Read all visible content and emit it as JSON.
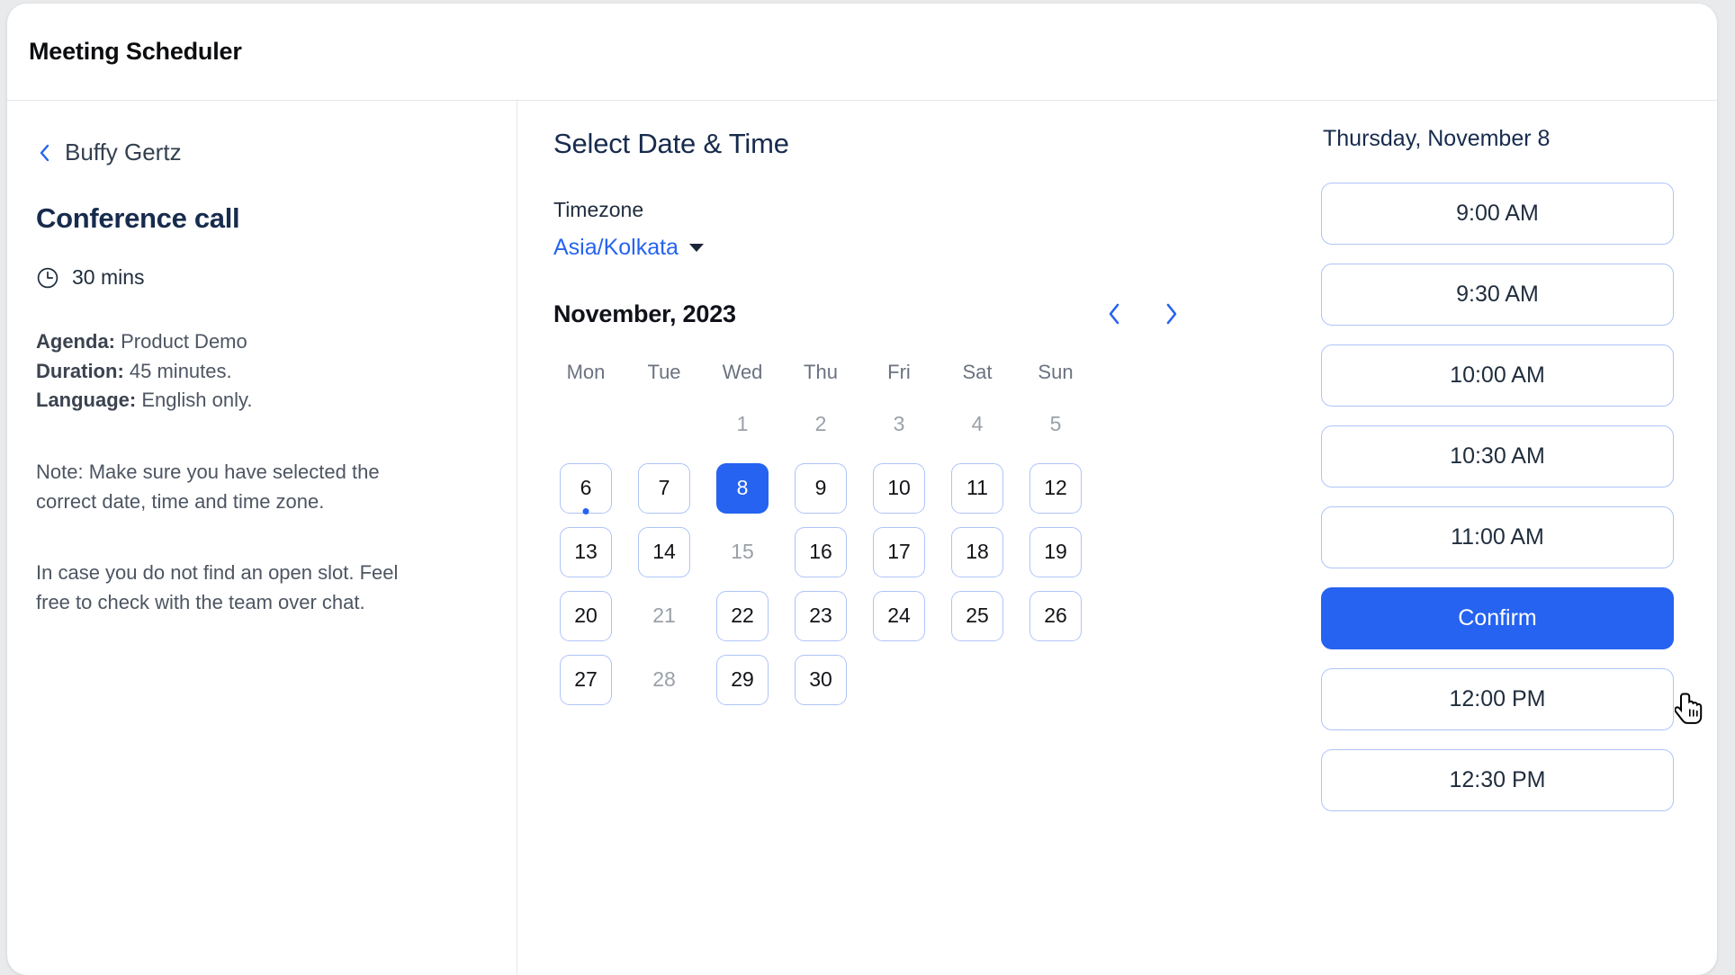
{
  "header": {
    "title": "Meeting Scheduler"
  },
  "sidebar": {
    "back_label": "Buffy Gertz",
    "event_title": "Conference call",
    "duration": "30 mins",
    "meta": [
      {
        "label": "Agenda:",
        "value": "Product Demo"
      },
      {
        "label": "Duration:",
        "value": "45 minutes."
      },
      {
        "label": "Language:",
        "value": "English only."
      }
    ],
    "note_1": "Note: Make sure you have selected the correct date, time and time zone.",
    "note_2": "In case you do not find an open slot. Feel free to check with the team over chat."
  },
  "calendar": {
    "section_title": "Select Date & Time",
    "timezone_label": "Timezone",
    "timezone_value": "Asia/Kolkata",
    "month_label": "November, 2023",
    "prev_label": "‹",
    "next_label": "›",
    "weekdays": [
      "Mon",
      "Tue",
      "Wed",
      "Thu",
      "Fri",
      "Sat",
      "Sun"
    ],
    "weeks": [
      [
        {
          "day": "",
          "state": "empty"
        },
        {
          "day": "",
          "state": "empty"
        },
        {
          "day": "1",
          "state": "disabled"
        },
        {
          "day": "2",
          "state": "disabled"
        },
        {
          "day": "3",
          "state": "disabled"
        },
        {
          "day": "4",
          "state": "disabled"
        },
        {
          "day": "5",
          "state": "disabled"
        }
      ],
      [
        {
          "day": "6",
          "state": "enabled",
          "dot": true
        },
        {
          "day": "7",
          "state": "enabled"
        },
        {
          "day": "8",
          "state": "selected"
        },
        {
          "day": "9",
          "state": "enabled"
        },
        {
          "day": "10",
          "state": "enabled"
        },
        {
          "day": "11",
          "state": "enabled"
        },
        {
          "day": "12",
          "state": "enabled"
        }
      ],
      [
        {
          "day": "13",
          "state": "enabled"
        },
        {
          "day": "14",
          "state": "enabled"
        },
        {
          "day": "15",
          "state": "disabled"
        },
        {
          "day": "16",
          "state": "enabled"
        },
        {
          "day": "17",
          "state": "enabled"
        },
        {
          "day": "18",
          "state": "enabled"
        },
        {
          "day": "19",
          "state": "enabled"
        }
      ],
      [
        {
          "day": "20",
          "state": "enabled"
        },
        {
          "day": "21",
          "state": "disabled"
        },
        {
          "day": "22",
          "state": "enabled"
        },
        {
          "day": "23",
          "state": "enabled"
        },
        {
          "day": "24",
          "state": "enabled"
        },
        {
          "day": "25",
          "state": "enabled"
        },
        {
          "day": "26",
          "state": "enabled"
        }
      ],
      [
        {
          "day": "27",
          "state": "enabled"
        },
        {
          "day": "28",
          "state": "disabled"
        },
        {
          "day": "29",
          "state": "enabled"
        },
        {
          "day": "30",
          "state": "enabled"
        },
        {
          "day": "",
          "state": "empty"
        },
        {
          "day": "",
          "state": "empty"
        },
        {
          "day": "",
          "state": "empty"
        }
      ]
    ]
  },
  "slots": {
    "date_label": "Thursday, November 8",
    "items": [
      {
        "label": "9:00 AM",
        "type": "slot"
      },
      {
        "label": "9:30 AM",
        "type": "slot"
      },
      {
        "label": "10:00 AM",
        "type": "slot"
      },
      {
        "label": "10:30 AM",
        "type": "slot"
      },
      {
        "label": "11:00 AM",
        "type": "slot"
      },
      {
        "label": "Confirm",
        "type": "confirm"
      },
      {
        "label": "12:00 PM",
        "type": "slot"
      },
      {
        "label": "12:30 PM",
        "type": "slot"
      }
    ]
  },
  "colors": {
    "accent": "#2563f0",
    "slot_border": "#aec4f7",
    "text_dark": "#172b4d",
    "text_muted": "#4d5562",
    "divider": "#e4e6e9"
  }
}
